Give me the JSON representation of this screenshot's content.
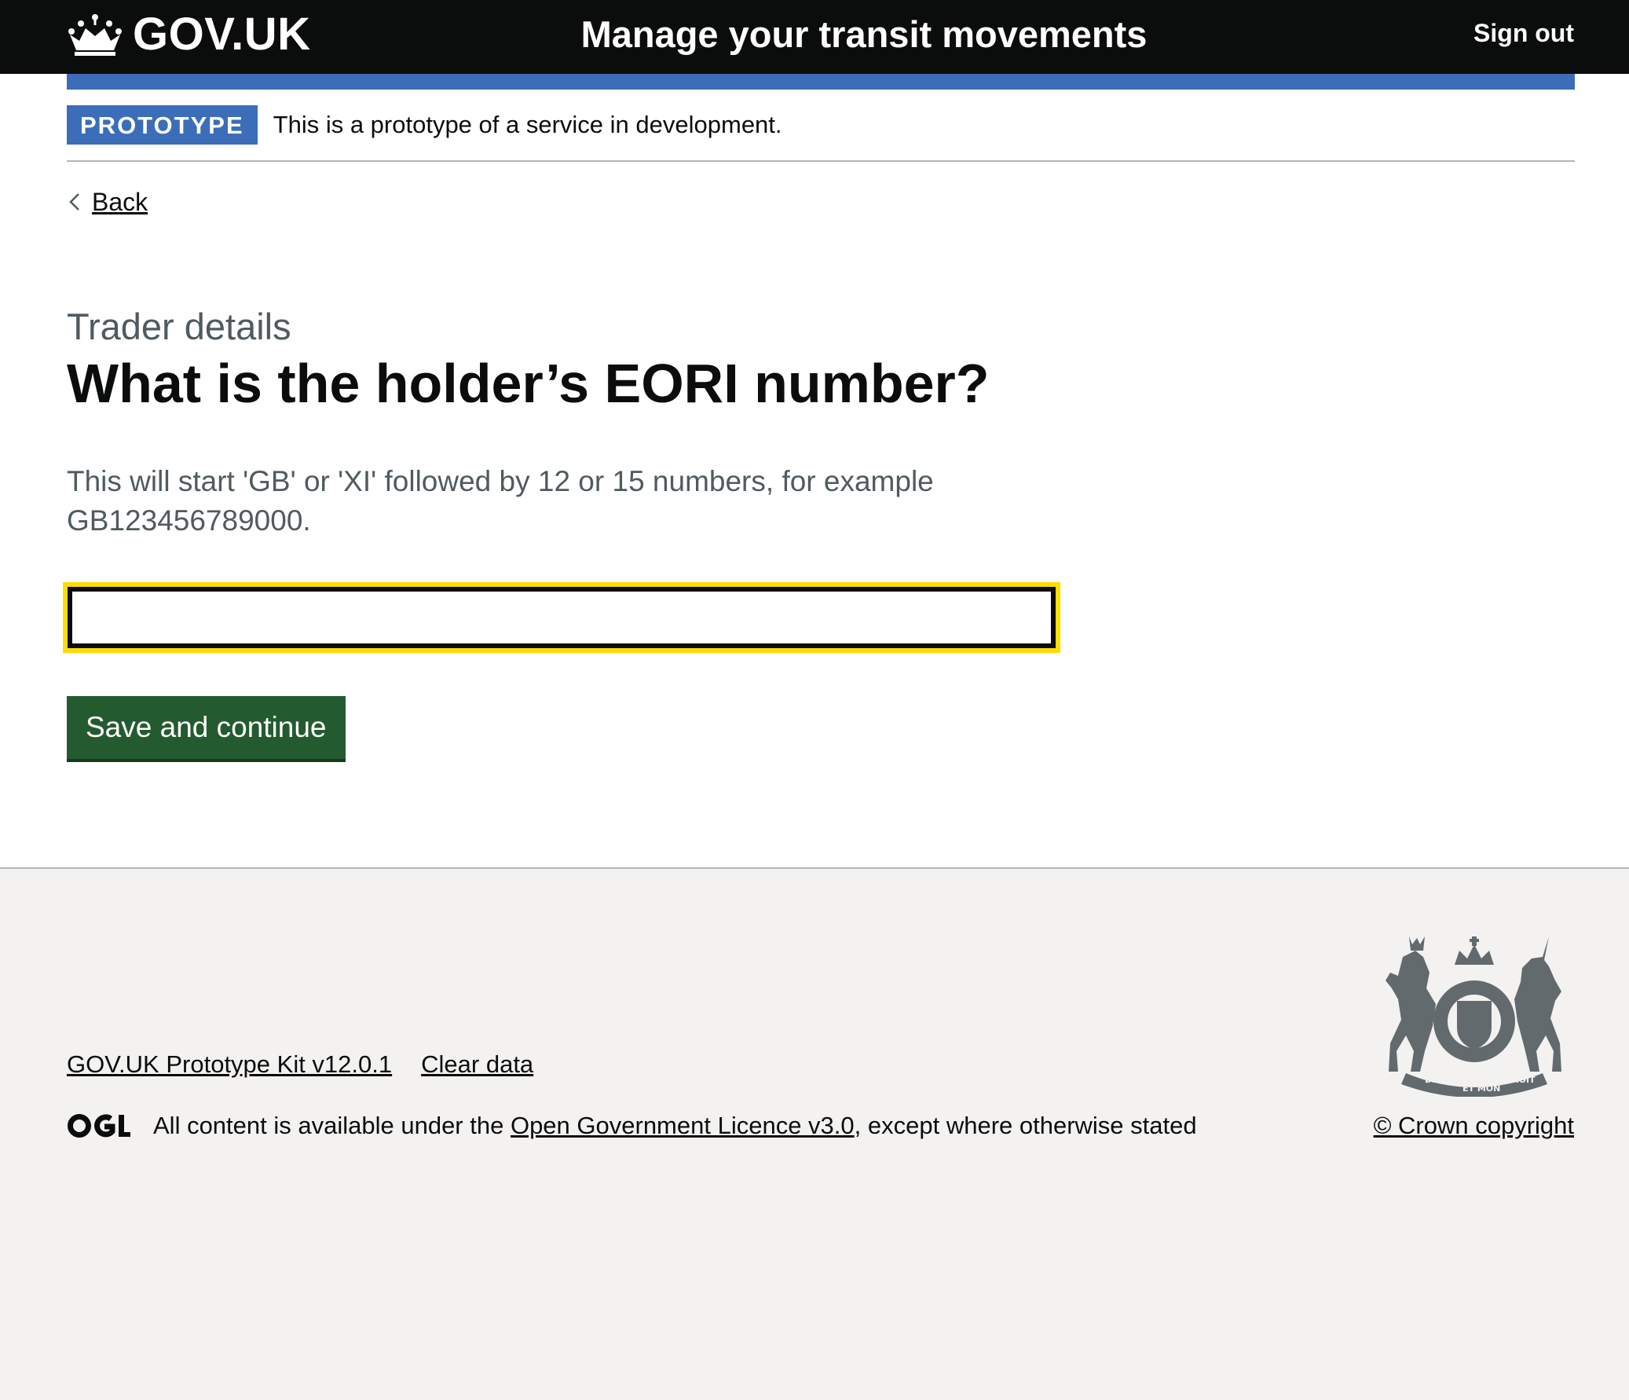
{
  "header": {
    "logo_text": "GOV.UK",
    "service_name": "Manage your transit movements",
    "sign_out_label": "Sign out"
  },
  "phase_banner": {
    "tag": "PROTOTYPE",
    "text": "This is a prototype of a service in development."
  },
  "back_link": {
    "label": "Back"
  },
  "main": {
    "caption": "Trader details",
    "heading": "What is the holder’s EORI number?",
    "hint": "This will start 'GB' or 'XI' followed by 12 or 15 numbers, for example GB123456789000.",
    "input_value": "",
    "input_placeholder": "",
    "submit_label": "Save and continue"
  },
  "footer": {
    "links": [
      {
        "label": "GOV.UK Prototype Kit v12.0.1"
      },
      {
        "label": "Clear data"
      }
    ],
    "licence_prefix": "All content is available under the ",
    "licence_link": "Open Government Licence v3.0",
    "licence_suffix": ", except where otherwise stated",
    "copyright": "© Crown copyright",
    "icons": [
      "crown-icon",
      "ogl-icon",
      "royal-coat-of-arms-icon",
      "chevron-left-icon"
    ]
  },
  "colors": {
    "header_bg": "#0b0c0c",
    "brand_blue": "#3b6db8",
    "focus_yellow": "#ffdd00",
    "button_green": "#245a30",
    "secondary_text": "#505a5f",
    "footer_bg": "#f3f2f1"
  }
}
